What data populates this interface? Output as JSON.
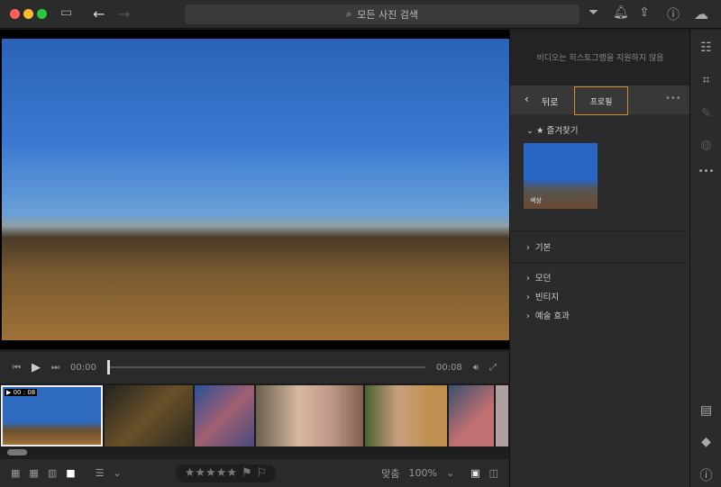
{
  "search": {
    "placeholder": "모든 사진 검색"
  },
  "player": {
    "time_current": "00:00",
    "time_end": "00:08",
    "thumb_badge": "▶ 00 : 08"
  },
  "bottom": {
    "fit_label": "맞춤",
    "zoom": "100%",
    "stars": "★★★★★"
  },
  "panel": {
    "histogram_msg": "비디오는 히스토그램을 지원하지 않음",
    "back_label": "뒤로",
    "profile_label": "프로필",
    "favorites_label": "즐겨찾기",
    "thumb_label": "색상",
    "groups": [
      "기본",
      "모던",
      "빈티지",
      "예술 효과"
    ]
  },
  "colors": {
    "accent": "#d88a2c"
  }
}
